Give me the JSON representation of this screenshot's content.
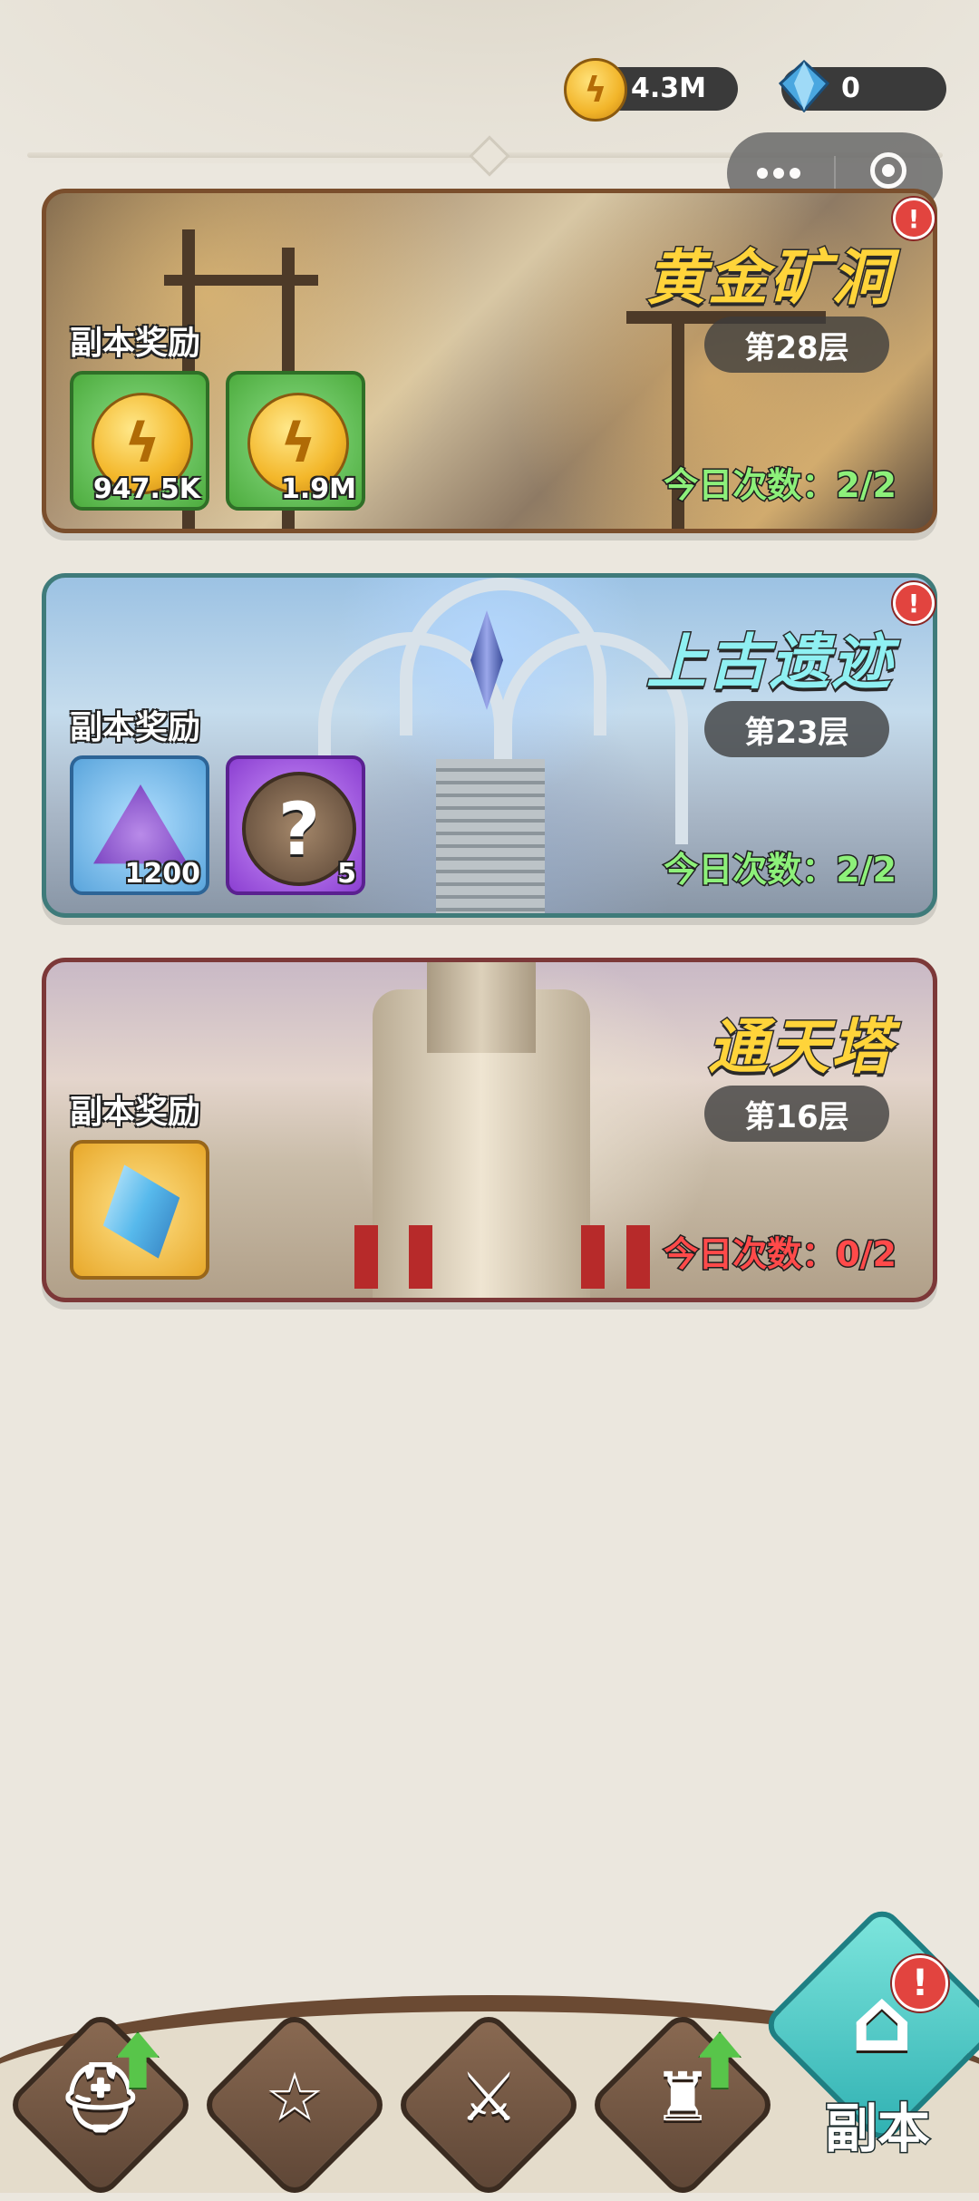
{
  "currency": {
    "gold": {
      "icon": "gold-coin-icon",
      "value": "4.3M"
    },
    "diamond": {
      "icon": "diamond-icon",
      "value": "0"
    }
  },
  "capsule": {
    "more_icon": "more-dots-icon",
    "close_icon": "target-icon"
  },
  "dungeons": [
    {
      "title": "黄金矿洞",
      "floor": "第28层",
      "reward_label": "副本奖励",
      "rewards": [
        {
          "icon": "gold-coin-icon",
          "count": "947.5K"
        },
        {
          "icon": "gold-coin-icon",
          "count": "1.9M"
        }
      ],
      "today": "今日次数：2/2",
      "alert": "!"
    },
    {
      "title": "上古遗迹",
      "floor": "第23层",
      "reward_label": "副本奖励",
      "rewards": [
        {
          "icon": "purple-gem-icon",
          "count": "1200"
        },
        {
          "icon": "mystery-box-icon",
          "count": "5"
        }
      ],
      "today": "今日次数：2/2",
      "alert": "!"
    },
    {
      "title": "通天塔",
      "floor": "第16层",
      "reward_label": "副本奖励",
      "rewards": [
        {
          "icon": "blue-crystal-icon",
          "count": ""
        }
      ],
      "today": "今日次数：0/2"
    }
  ],
  "nav": {
    "items": [
      {
        "icon": "helmet-icon",
        "upgrade": true
      },
      {
        "icon": "book-icon",
        "upgrade": false
      },
      {
        "icon": "crossed-swords-icon",
        "upgrade": false
      },
      {
        "icon": "castle-icon",
        "upgrade": true
      }
    ],
    "active": {
      "icon": "dungeon-gate-icon",
      "label": "副本",
      "alert": "!"
    }
  },
  "colors": {
    "background": "#ebe7de",
    "title_gold": "#ffd43a",
    "title_cyan": "#8ff0f2",
    "today_ok": "#8df07a",
    "today_zero": "#ff4a4a",
    "alert": "#e2443f"
  }
}
